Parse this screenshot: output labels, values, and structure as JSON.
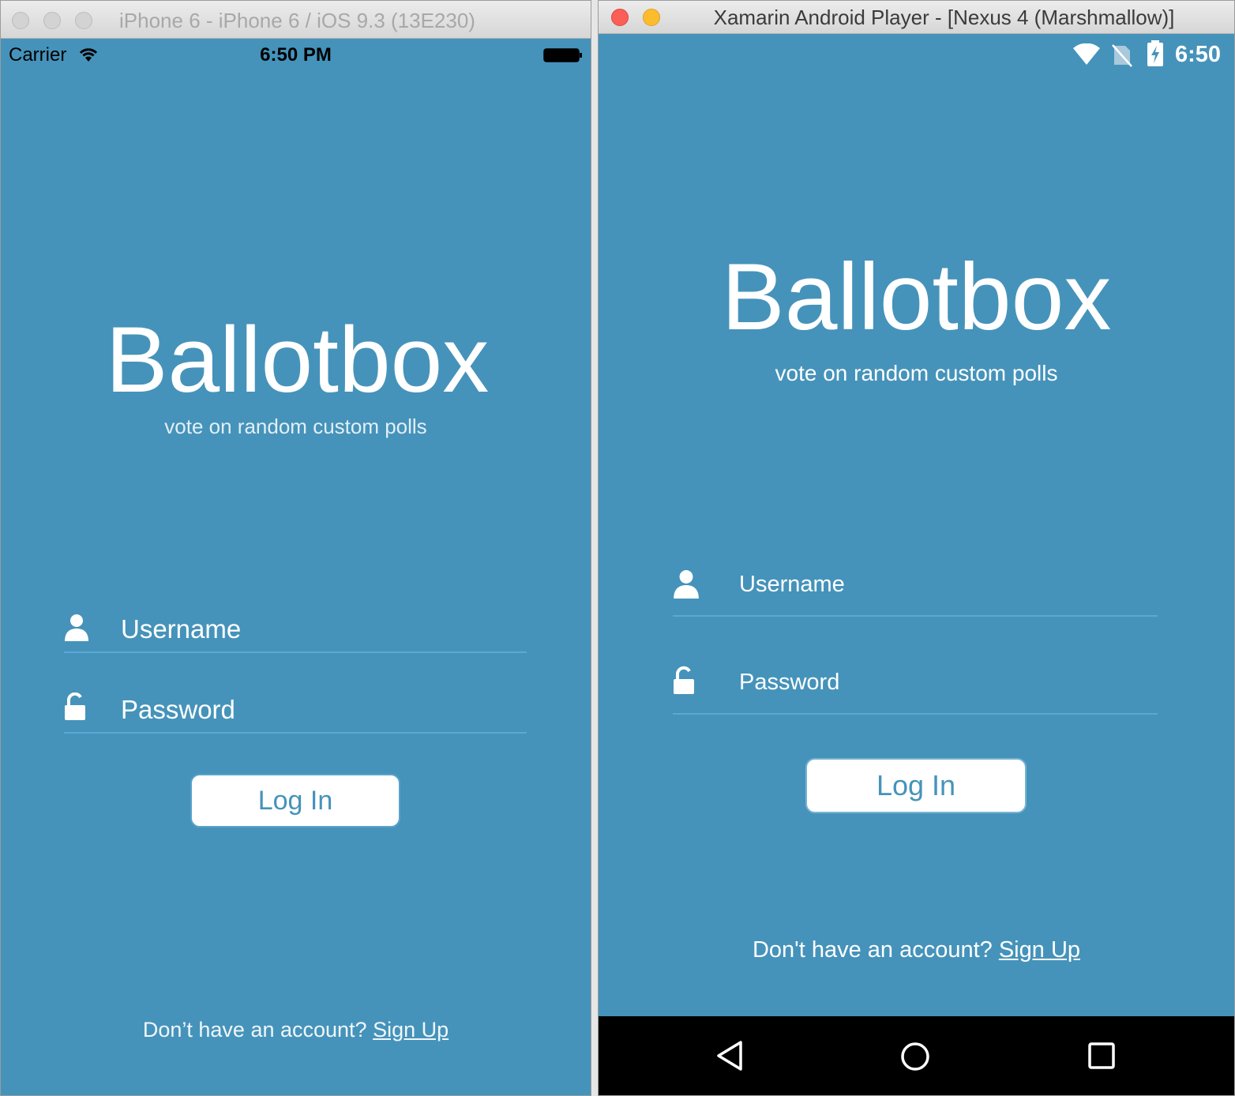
{
  "ios_window": {
    "title": "iPhone 6 - iPhone 6 / iOS 9.3 (13E230)",
    "status": {
      "carrier": "Carrier",
      "time": "6:50 PM"
    },
    "app": {
      "name": "Ballotbox",
      "tagline": "vote on random custom polls",
      "username_placeholder": "Username",
      "password_placeholder": "Password",
      "login_label": "Log In",
      "signup_prompt": "Don’t have an account?",
      "signup_link": "Sign Up"
    }
  },
  "android_window": {
    "title": "Xamarin Android Player - [Nexus 4 (Marshmallow)]",
    "status": {
      "time": "6:50"
    },
    "app": {
      "name": "Ballotbox",
      "tagline": "vote on random custom polls",
      "username_placeholder": "Username",
      "password_placeholder": "Password",
      "login_label": "Log In",
      "signup_prompt": "Don't have an account?",
      "signup_link": "Sign Up"
    }
  },
  "colors": {
    "background": "#4593ba",
    "field_underline": "#5aa8d6",
    "button_text": "#4593ba"
  },
  "icons": [
    "user-icon",
    "unlock-icon",
    "wifi-icon",
    "battery-icon",
    "no-sim-icon",
    "charging-battery-icon",
    "back-icon",
    "home-icon",
    "recents-icon"
  ]
}
